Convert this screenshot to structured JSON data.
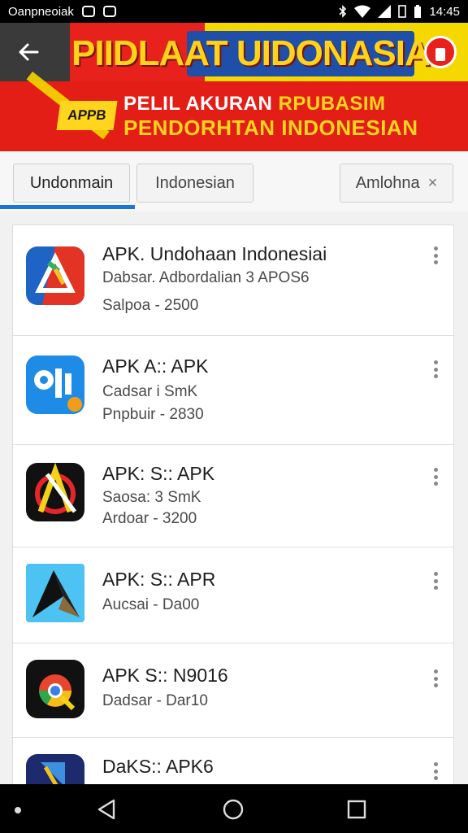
{
  "status_bar": {
    "carrier": "Oanpneoiak",
    "time": "14:45"
  },
  "banner": {
    "title": "PIIDLAAT UIDONASIAI",
    "badge": "APPB",
    "line1_white": "PELIL AKURAN",
    "line1_yellow": "RPUBASIM",
    "line2": "PENDORHTAN INDONESIAN",
    "colors": {
      "red": "#e7211b",
      "yellow": "#f4d800",
      "blue": "#1f4fa8"
    }
  },
  "tabs": [
    {
      "label": "Undonmain",
      "active": true
    },
    {
      "label": "Indonesian",
      "active": false
    },
    {
      "label": "Amlohna",
      "close": "×",
      "active": false
    }
  ],
  "apps": [
    {
      "name": "APK. Undohaan Indonesiai",
      "line1": "Dabsar. Adbordalian 3 APOS6",
      "line2": "Salpoa - 2500",
      "icon": "triangle-red-blue-icon"
    },
    {
      "name": "APK A:: APK",
      "line1": "Cadsar i SmK",
      "line2": "Pnpbuir - 2830",
      "icon": "blue-tools-icon"
    },
    {
      "name": "APK: S:: APK",
      "line1": "Saosa: 3 SmK",
      "line2": "Ardoar - 3200",
      "icon": "black-a-icon"
    },
    {
      "name": "APK: S:: APR",
      "line1": "Aucsai - Da00",
      "line2": "",
      "icon": "light-blue-arrow-icon"
    },
    {
      "name": "APK S:: N9016",
      "line1": "Dadsar - Dar10",
      "line2": "",
      "icon": "chrome-like-icon"
    },
    {
      "name": "DaKS:: APK6",
      "line1": "",
      "line2": "",
      "icon": "dark-blue-doc-icon"
    }
  ]
}
